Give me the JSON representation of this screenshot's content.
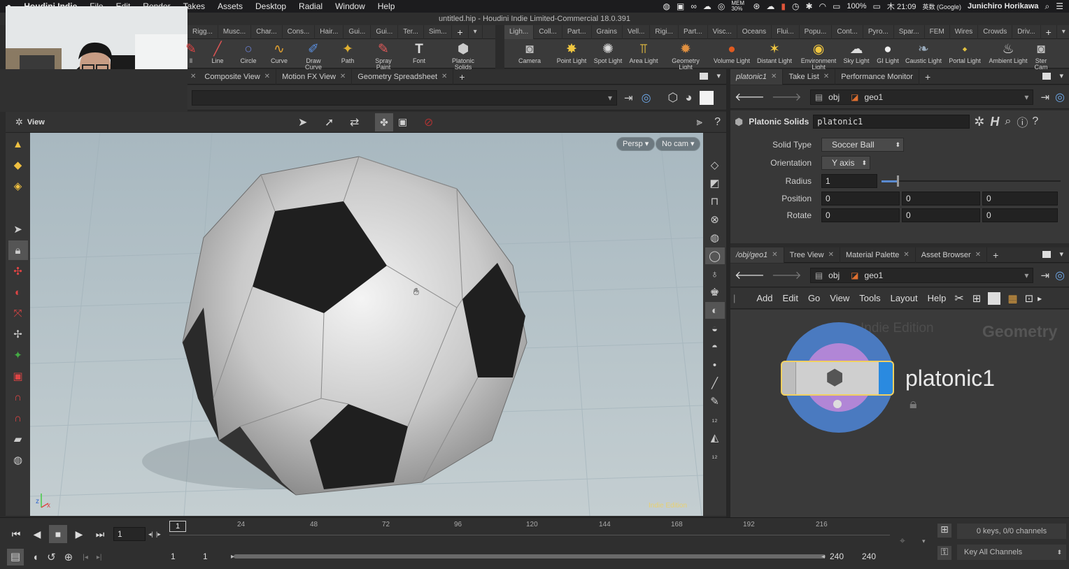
{
  "menubar": {
    "app_name": "Houdini Indie",
    "items": [
      "File",
      "Edit",
      "Render",
      "Takes",
      "Assets",
      "Desktop",
      "Radial",
      "Window",
      "Help"
    ],
    "mem": "MEM 30%",
    "battery": "100%",
    "day_time": "木 21:09",
    "input_source": "英数 (Google)",
    "user": "Junichiro Horikawa"
  },
  "window_title": "untitled.hip - Houdini Indie Limited-Commercial 18.0.391",
  "shelf_left": {
    "tabs": [
      "Rigg...",
      "Musc...",
      "Char...",
      "Cons...",
      "Hair...",
      "Gui...",
      "Gui...",
      "Ter...",
      "Sim..."
    ],
    "tools": [
      {
        "label": "ll",
        "icon": "partial-tool-icon"
      },
      {
        "label": "Line",
        "icon": "line-icon"
      },
      {
        "label": "Circle",
        "icon": "circle-icon"
      },
      {
        "label": "Curve",
        "icon": "curve-icon"
      },
      {
        "label": "Draw Curve",
        "icon": "draw-curve-icon"
      },
      {
        "label": "Path",
        "icon": "path-icon"
      },
      {
        "label": "Spray Paint",
        "icon": "spray-paint-icon"
      },
      {
        "label": "Font",
        "icon": "font-icon"
      },
      {
        "label": "Platonic\nSolids",
        "icon": "platonic-solids-icon"
      }
    ]
  },
  "shelf_right": {
    "tabs": [
      "Ligh...",
      "Coll...",
      "Part...",
      "Grains",
      "Vell...",
      "Rigi...",
      "Part...",
      "Visc...",
      "Oceans",
      "Flui...",
      "Popu...",
      "Cont...",
      "Pyro...",
      "Spar...",
      "FEM",
      "Wires",
      "Crowds",
      "Driv..."
    ],
    "tools": [
      {
        "label": "Camera",
        "icon": "camera-icon"
      },
      {
        "label": "Point Light",
        "icon": "point-light-icon"
      },
      {
        "label": "Spot Light",
        "icon": "spot-light-icon"
      },
      {
        "label": "Area Light",
        "icon": "area-light-icon"
      },
      {
        "label": "Geometry\nLight",
        "icon": "geometry-light-icon"
      },
      {
        "label": "Volume Light",
        "icon": "volume-light-icon"
      },
      {
        "label": "Distant Light",
        "icon": "distant-light-icon"
      },
      {
        "label": "Environment\nLight",
        "icon": "environment-light-icon"
      },
      {
        "label": "Sky Light",
        "icon": "sky-light-icon"
      },
      {
        "label": "GI Light",
        "icon": "gi-light-icon"
      },
      {
        "label": "Caustic Light",
        "icon": "caustic-light-icon"
      },
      {
        "label": "Portal Light",
        "icon": "portal-light-icon"
      },
      {
        "label": "Ambient Light",
        "icon": "ambient-light-icon"
      },
      {
        "label": "Ster\nCam",
        "icon": "stereo-camera-icon"
      }
    ]
  },
  "left_pane_tabs": [
    "Composite View",
    "Motion FX View",
    "Geometry Spreadsheet"
  ],
  "viewport": {
    "label": "View",
    "persp": "Persp",
    "cam": "No cam",
    "watermark": "Indie Edition",
    "axis_x": "x",
    "axis_z": "z"
  },
  "right_top": {
    "tabs": [
      "platonic1",
      "Take List",
      "Performance Monitor"
    ],
    "path_obj": "obj",
    "path_geo": "geo1",
    "node_type": "Platonic Solids",
    "node_name": "platonic1",
    "params": {
      "solid_type_label": "Solid Type",
      "solid_type_value": "Soccer Ball",
      "orientation_label": "Orientation",
      "orientation_value": "Y axis",
      "radius_label": "Radius",
      "radius_value": "1",
      "position_label": "Position",
      "position_values": [
        "0",
        "0",
        "0"
      ],
      "rotate_label": "Rotate",
      "rotate_values": [
        "0",
        "0",
        "0"
      ]
    }
  },
  "right_bottom": {
    "tabs": [
      "/obj/geo1",
      "Tree View",
      "Material Palette",
      "Asset Browser"
    ],
    "path_obj": "obj",
    "path_geo": "geo1",
    "menu": [
      "Add",
      "Edit",
      "Go",
      "View",
      "Tools",
      "Layout",
      "Help"
    ],
    "watermark": "Indie Edition",
    "context_label": "Geometry",
    "node_name": "platonic1"
  },
  "timeline": {
    "frame": "1",
    "ticks": [
      "24",
      "48",
      "72",
      "96",
      "120",
      "144",
      "168",
      "192",
      "216"
    ],
    "current_marker": "1",
    "range_start": "1",
    "range_start2": "1",
    "range_end": "240",
    "range_end2": "240",
    "keys_info": "0 keys, 0/0 channels",
    "key_all": "Key All Channels"
  }
}
